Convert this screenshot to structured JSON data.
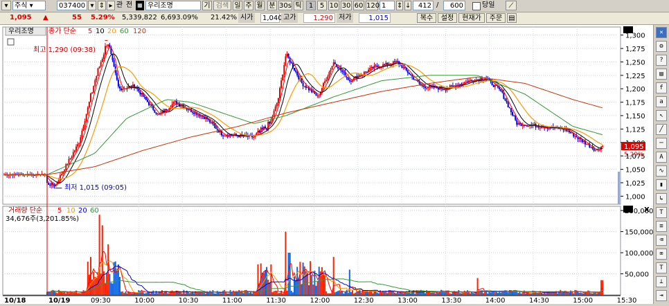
{
  "toolbar": {
    "market_select": "주식",
    "code_value": "037400",
    "watch_label": "관",
    "mode_label": "전",
    "name_value": "우리조명",
    "period_label": "기",
    "search_label": "검색",
    "period_buttons": [
      "일",
      "주",
      "월",
      "분",
      "30s",
      "틱"
    ],
    "interval_buttons": [
      "1",
      "5",
      "10",
      "30",
      "60",
      "120"
    ],
    "interval_value": "1",
    "count_value": "412",
    "count_total": "600",
    "same_day_label": "당일"
  },
  "infobar": {
    "price": "1,095",
    "change_arrow": "▲",
    "change": "55",
    "change_pct": "5.29%",
    "volume": "5,339,822",
    "volume_pct": "6,693.09%",
    "turnover_pct": "21.42%",
    "open_label": "시가",
    "open_value": "1,040",
    "high_label": "고가",
    "high_value": "1,290",
    "low_label": "저가",
    "low_value": "1,015",
    "buttons": [
      "복수",
      "설정",
      "현재가",
      "주문"
    ]
  },
  "price_panel": {
    "stock_tag": "우리조명",
    "legend_prefix": "종가 단순",
    "ma_labels": [
      "5",
      "10",
      "20",
      "60",
      "120"
    ],
    "ma_colors": [
      "#ff0000",
      "#000000",
      "#ff9900",
      "#339933",
      "#cc3300"
    ],
    "high_note": "최고 1,290 (09:38)",
    "low_note": "최저 1,015 (09:05)",
    "current_price_tag": "1,095",
    "current_pct_tag": "5.29%"
  },
  "volume_panel": {
    "legend_prefix": "거래량 단순",
    "ma_labels": [
      "5",
      "10",
      "20",
      "60"
    ],
    "ma_colors": [
      "#ff0000",
      "#ff9900",
      "#0000cc",
      "#339933"
    ],
    "total_note": "34,676주(3,201.85%)"
  },
  "x_axis": {
    "date_labels": [
      "10/18",
      "10/19"
    ],
    "time_labels": [
      "09:30",
      "10:00",
      "10:30",
      "11:00",
      "11:30",
      "12:00",
      "12:30",
      "13:00",
      "13:30",
      "14:00",
      "14:30",
      "15:00",
      "15:30"
    ]
  },
  "chart_data": [
    {
      "type": "candlestick",
      "title": "",
      "ylim": [
        985,
        1315
      ],
      "y_ticks": [
        1000,
        1025,
        1050,
        1075,
        1100,
        1125,
        1150,
        1175,
        1200,
        1225,
        1250,
        1275,
        1300
      ],
      "y_tick_labels": [
        "1,000",
        "1,025",
        "1,050",
        "1,075",
        "1,100",
        "1,125",
        "1,150",
        "1,175",
        "1,200",
        "1,225",
        "1,250",
        "1,275",
        "1,300"
      ],
      "x_labels": [
        "09:30",
        "10:00",
        "10:30",
        "11:00",
        "11:30",
        "12:00",
        "12:30",
        "13:00",
        "13:30",
        "14:00",
        "14:30",
        "15:00",
        "15:30"
      ],
      "prev_close": 1040,
      "close_path_keypoints": [
        {
          "t": "10/18",
          "p": 1040
        },
        {
          "t": "09:05",
          "p": 1020
        },
        {
          "t": "09:20",
          "p": 1100
        },
        {
          "t": "09:30",
          "p": 1215
        },
        {
          "t": "09:38",
          "p": 1290
        },
        {
          "t": "09:45",
          "p": 1200
        },
        {
          "t": "09:55",
          "p": 1205
        },
        {
          "t": "10:10",
          "p": 1150
        },
        {
          "t": "10:20",
          "p": 1175
        },
        {
          "t": "10:40",
          "p": 1145
        },
        {
          "t": "10:50",
          "p": 1115
        },
        {
          "t": "11:10",
          "p": 1110
        },
        {
          "t": "11:20",
          "p": 1135
        },
        {
          "t": "11:25",
          "p": 1180
        },
        {
          "t": "11:30",
          "p": 1265
        },
        {
          "t": "11:40",
          "p": 1210
        },
        {
          "t": "11:50",
          "p": 1185
        },
        {
          "t": "12:00",
          "p": 1250
        },
        {
          "t": "12:10",
          "p": 1215
        },
        {
          "t": "12:25",
          "p": 1240
        },
        {
          "t": "12:40",
          "p": 1250
        },
        {
          "t": "12:55",
          "p": 1205
        },
        {
          "t": "13:10",
          "p": 1200
        },
        {
          "t": "13:25",
          "p": 1215
        },
        {
          "t": "13:35",
          "p": 1220
        },
        {
          "t": "13:45",
          "p": 1195
        },
        {
          "t": "13:55",
          "p": 1135
        },
        {
          "t": "14:10",
          "p": 1130
        },
        {
          "t": "14:25",
          "p": 1125
        },
        {
          "t": "14:35",
          "p": 1105
        },
        {
          "t": "14:45",
          "p": 1085
        },
        {
          "t": "14:55",
          "p": 1110
        },
        {
          "t": "15:05",
          "p": 1100
        },
        {
          "t": "15:15",
          "p": 1095
        }
      ],
      "ma120_keypoints": [
        {
          "t": "09:00",
          "p": 1040
        },
        {
          "t": "09:30",
          "p": 1055
        },
        {
          "t": "10:00",
          "p": 1085
        },
        {
          "t": "10:30",
          "p": 1110
        },
        {
          "t": "11:00",
          "p": 1130
        },
        {
          "t": "11:30",
          "p": 1155
        },
        {
          "t": "12:00",
          "p": 1175
        },
        {
          "t": "12:30",
          "p": 1195
        },
        {
          "t": "13:00",
          "p": 1210
        },
        {
          "t": "13:30",
          "p": 1222
        },
        {
          "t": "14:00",
          "p": 1210
        },
        {
          "t": "14:30",
          "p": 1180
        },
        {
          "t": "15:00",
          "p": 1155
        },
        {
          "t": "15:15",
          "p": 1140
        }
      ],
      "ma60_keypoints": [
        {
          "t": "09:00",
          "p": 1040
        },
        {
          "t": "09:30",
          "p": 1080
        },
        {
          "t": "09:50",
          "p": 1145
        },
        {
          "t": "10:15",
          "p": 1180
        },
        {
          "t": "10:30",
          "p": 1175
        },
        {
          "t": "10:50",
          "p": 1155
        },
        {
          "t": "11:10",
          "p": 1135
        },
        {
          "t": "11:30",
          "p": 1150
        },
        {
          "t": "12:00",
          "p": 1185
        },
        {
          "t": "12:30",
          "p": 1215
        },
        {
          "t": "13:00",
          "p": 1225
        },
        {
          "t": "13:30",
          "p": 1225
        },
        {
          "t": "14:00",
          "p": 1190
        },
        {
          "t": "14:30",
          "p": 1130
        },
        {
          "t": "15:00",
          "p": 1105
        },
        {
          "t": "15:15",
          "p": 1100
        }
      ]
    },
    {
      "type": "bar",
      "title": "",
      "ylim": [
        0,
        210000
      ],
      "y_ticks": [
        50000,
        100000,
        150000,
        200000
      ],
      "y_tick_labels": [
        "50,000",
        "100,000",
        "150,000",
        "200,000"
      ],
      "x_labels": [
        "09:30",
        "10:00",
        "10:30",
        "11:00",
        "11:30",
        "12:00",
        "12:30",
        "13:00",
        "13:30",
        "14:00",
        "14:30",
        "15:00",
        "15:30"
      ],
      "volume_peaks": [
        {
          "t": "09:33",
          "v": 190000
        },
        {
          "t": "09:35",
          "v": 165000
        },
        {
          "t": "09:38",
          "v": 120000
        },
        {
          "t": "09:27",
          "v": 90000
        },
        {
          "t": "11:30",
          "v": 150000
        },
        {
          "t": "11:32",
          "v": 100000
        },
        {
          "t": "11:45",
          "v": 80000
        },
        {
          "t": "12:00",
          "v": 90000
        },
        {
          "t": "12:10",
          "v": 60000
        },
        {
          "t": "13:30",
          "v": 40000
        },
        {
          "t": "15:18",
          "v": 35000
        }
      ]
    }
  ]
}
